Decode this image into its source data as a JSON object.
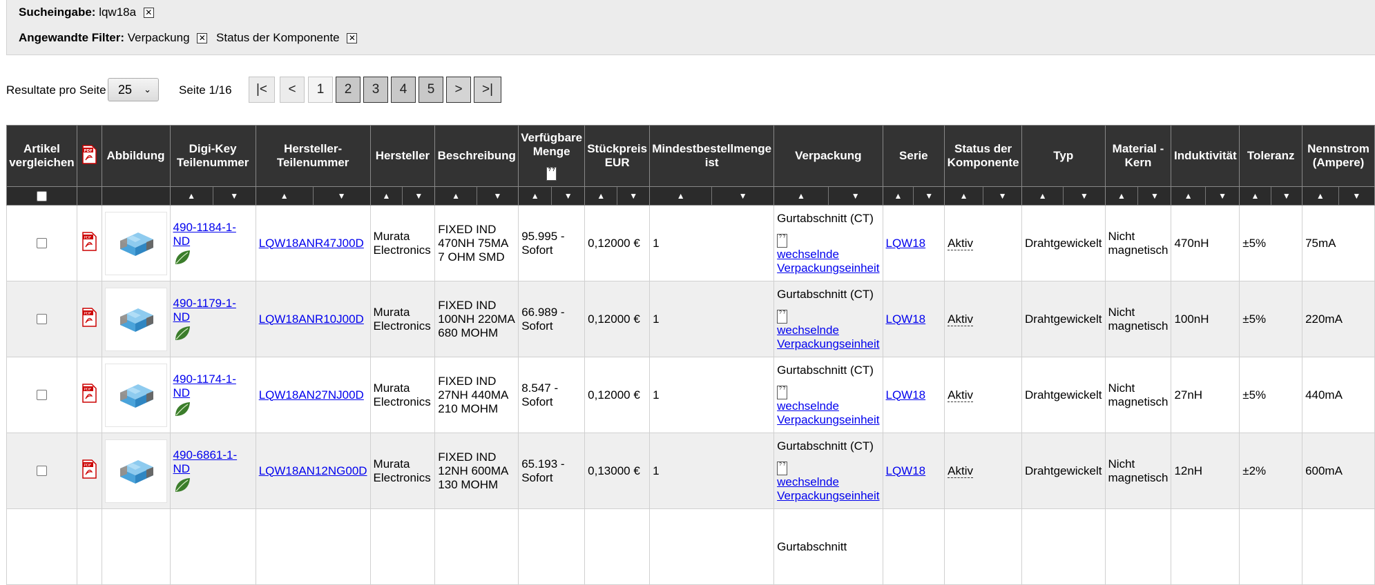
{
  "filters": {
    "search_label": "Sucheingabe:",
    "search_value": "lqw18a",
    "applied_label": "Angewandte Filter:",
    "applied": [
      "Verpackung",
      "Status der Komponente"
    ]
  },
  "pager": {
    "per_page_label": "Resultate pro Seite",
    "per_page_value": "25",
    "page_info": "Seite 1/16",
    "first": "|<",
    "prev": "<",
    "pages": [
      "1",
      "2",
      "3",
      "4",
      "5"
    ],
    "next": ">",
    "last": ">|"
  },
  "table": {
    "headers": {
      "compare": "Artikel vergleichen",
      "image": "Abbildung",
      "dk_pn": "Digi-Key Teilenummer",
      "mfr_pn": "Hersteller-Teilenummer",
      "mfr": "Hersteller",
      "desc": "Beschreibung",
      "qty": "Verfügbare Menge",
      "price": "Stückpreis EUR",
      "minqty": "Mindestbestellmenge ist",
      "pack": "Verpackung",
      "series": "Serie",
      "status": "Status der Komponente",
      "type": "Typ",
      "material": "Material - Kern",
      "induct": "Induktivität",
      "tol": "Toleranz",
      "current": "Nennstrom (Ampere)"
    },
    "rows": [
      {
        "dk_pn": "490-1184-1-ND",
        "mfr_pn": "LQW18ANR47J00D",
        "mfr": "Murata Electronics",
        "desc": "FIXED IND 470NH 75MA 7 OHM SMD",
        "qty": "95.995 - Sofort",
        "price": "0,12000 €",
        "minqty": "1",
        "pack": "Gurtabschnitt (CT)",
        "pack_link": "wechselnde Verpackungseinheit",
        "series": "LQW18",
        "status": "Aktiv",
        "type": "Drahtgewickelt",
        "material": "Nicht magnetisch",
        "induct": "470nH",
        "tol": "±5%",
        "current": "75mA"
      },
      {
        "dk_pn": "490-1179-1-ND",
        "mfr_pn": "LQW18ANR10J00D",
        "mfr": "Murata Electronics",
        "desc": "FIXED IND 100NH 220MA 680 MOHM",
        "qty": "66.989 - Sofort",
        "price": "0,12000 €",
        "minqty": "1",
        "pack": "Gurtabschnitt (CT)",
        "pack_link": "wechselnde Verpackungseinheit",
        "series": "LQW18",
        "status": "Aktiv",
        "type": "Drahtgewickelt",
        "material": "Nicht magnetisch",
        "induct": "100nH",
        "tol": "±5%",
        "current": "220mA"
      },
      {
        "dk_pn": "490-1174-1-ND",
        "mfr_pn": "LQW18AN27NJ00D",
        "mfr": "Murata Electronics",
        "desc": "FIXED IND 27NH 440MA 210 MOHM",
        "qty": "8.547 - Sofort",
        "price": "0,12000 €",
        "minqty": "1",
        "pack": "Gurtabschnitt (CT)",
        "pack_link": "wechselnde Verpackungseinheit",
        "series": "LQW18",
        "status": "Aktiv",
        "type": "Drahtgewickelt",
        "material": "Nicht magnetisch",
        "induct": "27nH",
        "tol": "±5%",
        "current": "440mA"
      },
      {
        "dk_pn": "490-6861-1-ND",
        "mfr_pn": "LQW18AN12NG00D",
        "mfr": "Murata Electronics",
        "desc": "FIXED IND 12NH 600MA 130 MOHM",
        "qty": "65.193 - Sofort",
        "price": "0,13000 €",
        "minqty": "1",
        "pack": "Gurtabschnitt (CT)",
        "pack_link": "wechselnde Verpackungseinheit",
        "series": "LQW18",
        "status": "Aktiv",
        "type": "Drahtgewickelt",
        "material": "Nicht magnetisch",
        "induct": "12nH",
        "tol": "±2%",
        "current": "600mA"
      },
      {
        "pack": "Gurtabschnitt"
      }
    ]
  }
}
